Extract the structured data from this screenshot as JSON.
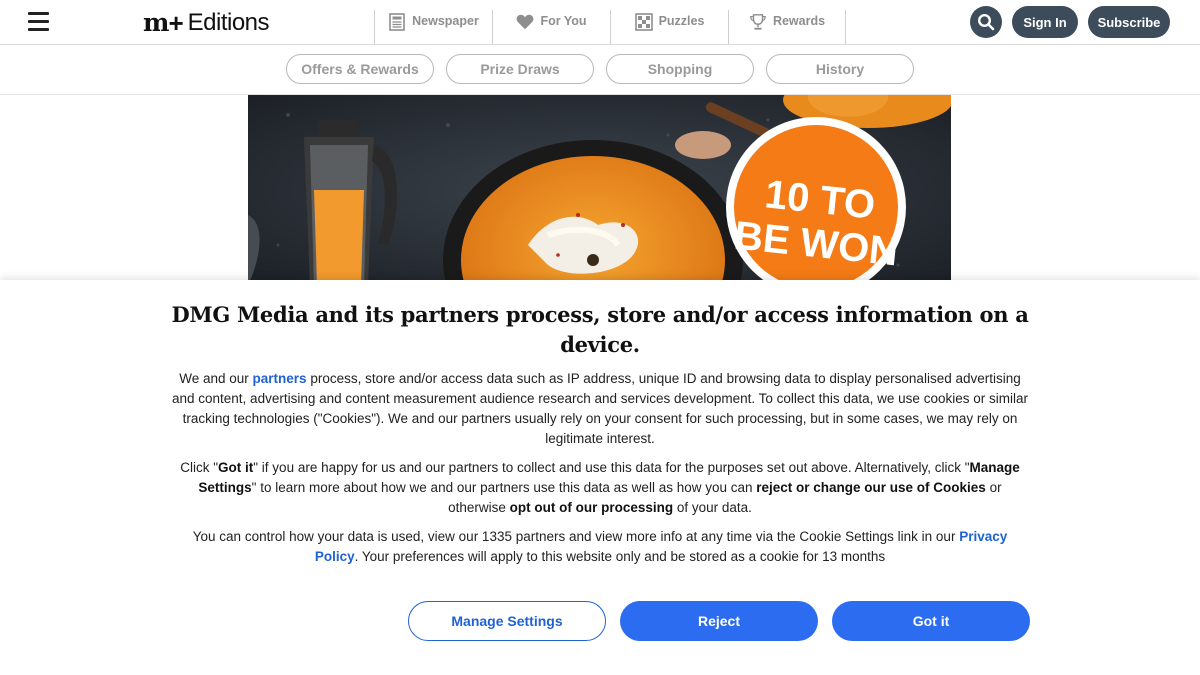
{
  "header": {
    "logo_mark": "m",
    "logo_plus": "+",
    "logo_text": "Editions",
    "nav": [
      {
        "label": "Newspaper",
        "icon": "newspaper-icon"
      },
      {
        "label": "For You",
        "icon": "heart-icon"
      },
      {
        "label": "Puzzles",
        "icon": "puzzle-grid-icon"
      },
      {
        "label": "Rewards",
        "icon": "trophy-icon"
      }
    ],
    "signin_label": "Sign In",
    "subscribe_label": "Subscribe"
  },
  "subnav": {
    "items": [
      "Offers & Rewards",
      "Prize Draws",
      "Shopping",
      "History"
    ]
  },
  "hero": {
    "badge_line1": "10 TO",
    "badge_line2": "BE WON"
  },
  "consent": {
    "title": "DMG Media and its partners process, store and/or access information on a device.",
    "p1_before": "We and our ",
    "p1_link": "partners",
    "p1_after": " process, store and/or access data such as IP address, unique ID and browsing data to display personalised advertising and content, advertising and content measurement audience research and services development. To collect this data, we use cookies or similar tracking technologies (\"Cookies\"). We and our partners usually rely on your consent for such processing, but in some cases, we may rely on legitimate interest.",
    "p2_a": "Click \"",
    "p2_b": "Got it",
    "p2_c": "\" if you are happy for us and our partners to collect and use this data for the purposes set out above. Alternatively, click \"",
    "p2_d": "Manage Settings",
    "p2_e": "\" to learn more about how we and our partners use this data as well as how you can ",
    "p2_f": "reject or change our use of Cookies",
    "p2_g": " or otherwise ",
    "p2_h": "opt out of our processing",
    "p2_i": " of your data.",
    "p3_before": "You can control how your data is used, view our 1335 partners and view more info at any time via the Cookie Settings link in our ",
    "p3_link": "Privacy Policy",
    "p3_after": ". Your preferences will apply to this website only and be stored as a cookie for 13 months",
    "buttons": {
      "manage": "Manage Settings",
      "reject": "Reject",
      "gotit": "Got it"
    }
  },
  "colors": {
    "header_button": "#3d4c5a",
    "primary_blue": "#2b6cf0",
    "link_blue": "#1f62d3",
    "badge_orange": "#f47b16"
  }
}
